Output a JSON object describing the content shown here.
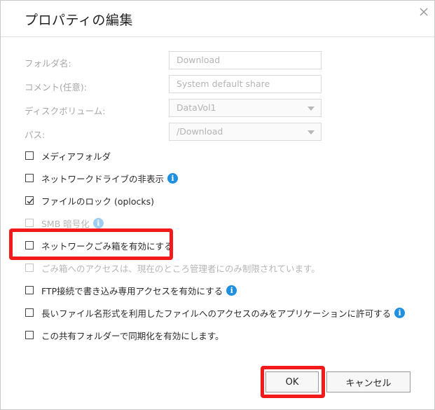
{
  "dialog": {
    "title": "プロパティの編集"
  },
  "fields": [
    {
      "label": "フォルダ名:",
      "value": "Download",
      "type": "text"
    },
    {
      "label": "コメント(任意):",
      "value": "System default share",
      "type": "text"
    },
    {
      "label": "ディスクボリューム:",
      "value": "DataVol1",
      "type": "select"
    },
    {
      "label": "パス:",
      "value": "/Download",
      "type": "select"
    }
  ],
  "options": [
    {
      "label": "メディアフォルダ",
      "checked": false,
      "disabled": false,
      "info": false
    },
    {
      "label": "ネットワークドライブの非表示",
      "checked": false,
      "disabled": false,
      "info": true
    },
    {
      "label": "ファイルのロック (oplocks)",
      "checked": true,
      "disabled": false,
      "info": false
    },
    {
      "label": "SMB 暗号化",
      "checked": false,
      "disabled": true,
      "info": true
    },
    {
      "label": "ネットワークごみ箱を有効にする",
      "checked": false,
      "disabled": false,
      "info": false
    },
    {
      "label": "ごみ箱へのアクセスは、現在のところ管理者にのみ制限されています。",
      "checked": false,
      "disabled": true,
      "info": false
    },
    {
      "label": "FTP接続で書き込み専用アクセスを有効にする",
      "checked": false,
      "disabled": false,
      "info": true
    },
    {
      "label": "長いファイル名形式を利用したファイルへのアクセスのみをアプリケーションに許可する",
      "checked": false,
      "disabled": false,
      "info": true
    },
    {
      "label": "この共有フォルダーで同期化を有効にします。",
      "checked": false,
      "disabled": false,
      "info": false
    }
  ],
  "icons": {
    "close": "close-icon",
    "info": "info-icon",
    "info_glyph": "i",
    "check": "check-icon",
    "caret": "chevron-down-icon"
  },
  "buttons": {
    "ok": "OK",
    "cancel": "キャンセル"
  },
  "colors": {
    "highlight": "#f21a1a",
    "info": "#1f8fe0"
  }
}
